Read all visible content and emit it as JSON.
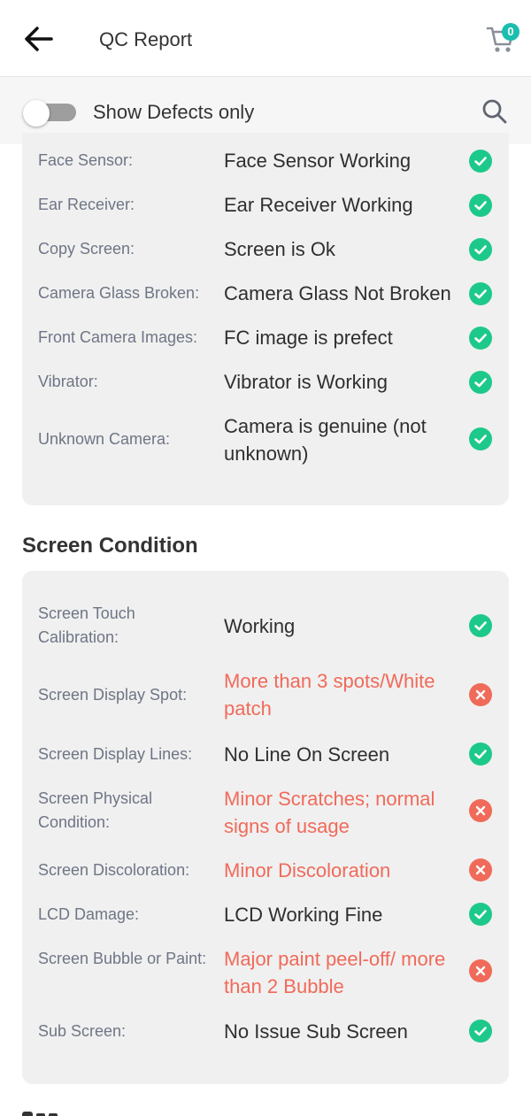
{
  "header": {
    "title": "QC Report",
    "cart_count": "0"
  },
  "filter": {
    "toggle_label": "Show Defects only"
  },
  "sections": [
    {
      "title": "",
      "rows": [
        {
          "label": "Face Sensor:",
          "value": "Face Sensor Working",
          "status": "ok"
        },
        {
          "label": "Ear Receiver:",
          "value": "Ear Receiver Working",
          "status": "ok"
        },
        {
          "label": "Copy Screen:",
          "value": "Screen is Ok",
          "status": "ok"
        },
        {
          "label": "Camera Glass Broken:",
          "value": "Camera Glass Not Broken",
          "status": "ok"
        },
        {
          "label": "Front Camera Images:",
          "value": "FC image is prefect",
          "status": "ok"
        },
        {
          "label": "Vibrator:",
          "value": "Vibrator is Working",
          "status": "ok"
        },
        {
          "label": "Unknown Camera:",
          "value": "Camera is genuine (not unknown)",
          "status": "ok"
        }
      ]
    },
    {
      "title": "Screen Condition",
      "rows": [
        {
          "label": "Screen Touch Calibration:",
          "value": "Working",
          "status": "ok"
        },
        {
          "label": "Screen Display Spot:",
          "value": "More than 3 spots/White patch",
          "status": "defect"
        },
        {
          "label": "Screen Display Lines:",
          "value": "No Line On Screen",
          "status": "ok"
        },
        {
          "label": "Screen Physical Condition:",
          "value": "Minor Scratches; normal signs of usage",
          "status": "defect"
        },
        {
          "label": "Screen Discoloration:",
          "value": "Minor Discoloration",
          "status": "defect"
        },
        {
          "label": "LCD Damage:",
          "value": "LCD Working Fine",
          "status": "ok"
        },
        {
          "label": "Screen Bubble or Paint:",
          "value": "Major paint peel-off/ more than 2 Bubble",
          "status": "defect"
        },
        {
          "label": "Sub Screen:",
          "value": "No Issue Sub Screen",
          "status": "ok"
        }
      ]
    }
  ],
  "colors": {
    "ok": "#1dc98a",
    "defect": "#f06a5a",
    "accent": "#1cbeae"
  },
  "icons": {
    "back": "arrow-left-icon",
    "cart": "cart-icon",
    "search": "search-icon",
    "ok": "check-circle-icon",
    "defect": "x-circle-icon"
  }
}
